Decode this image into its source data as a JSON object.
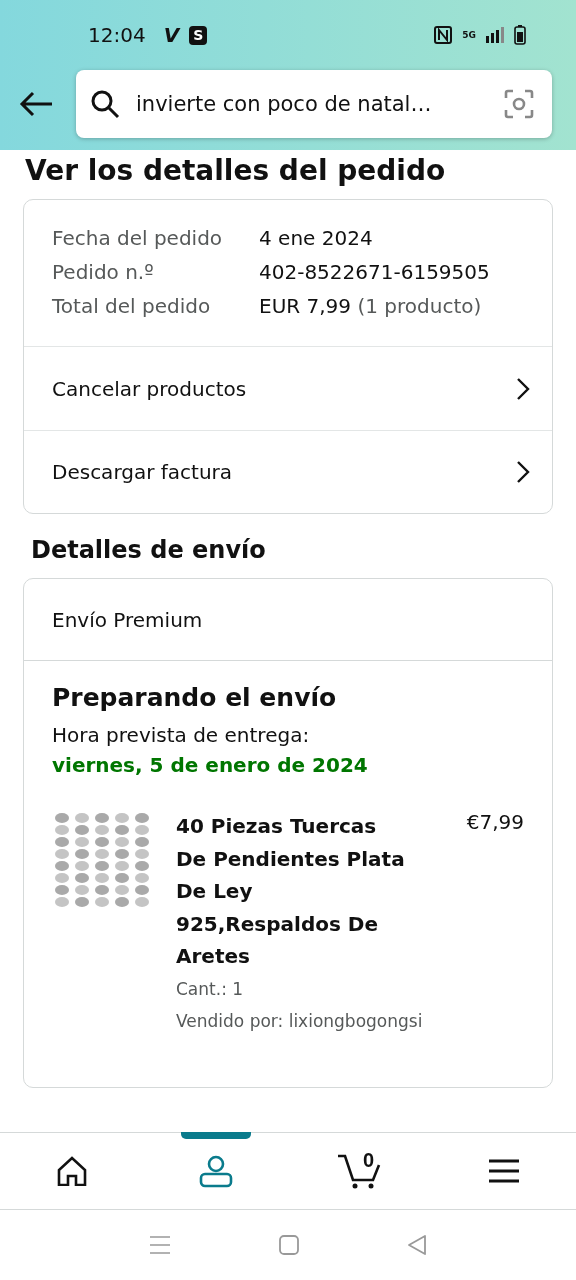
{
  "status_bar": {
    "time": "12:04",
    "app_badges": [
      "V",
      "S"
    ],
    "network": "5G"
  },
  "search": {
    "value": "invierte con poco de natal…"
  },
  "page_title": "Ver los detalles del pedido",
  "order_summary": {
    "rows": [
      {
        "label": "Fecha del pedido",
        "value": "4 ene 2024"
      },
      {
        "label": "Pedido n.º",
        "value": "402-8522671-6159505"
      },
      {
        "label": "Total del pedido",
        "value": "EUR 7,99",
        "note": "(1 producto)"
      }
    ],
    "actions": [
      "Cancelar productos",
      "Descargar factura"
    ]
  },
  "shipping_title": "Detalles de envío",
  "shipment": {
    "method": "Envío Premium",
    "status": "Preparando el envío",
    "delivery_label": "Hora prevista de entrega:",
    "delivery_date": "viernes, 5 de enero de 2024",
    "item": {
      "kind": "picture",
      "title": "40 Piezas Tuercas De Pendientes Plata De Ley 925,Respaldos De Aretes",
      "price": "€7,99",
      "quantity": "Cant.: 1",
      "seller": "Vendido por: lixiongbogongsi"
    }
  },
  "bottom_nav": [
    {
      "kind": "home",
      "selected": false
    },
    {
      "kind": "account",
      "selected": true
    },
    {
      "kind": "cart",
      "selected": false,
      "count": "0"
    },
    {
      "kind": "menu",
      "selected": false
    }
  ]
}
